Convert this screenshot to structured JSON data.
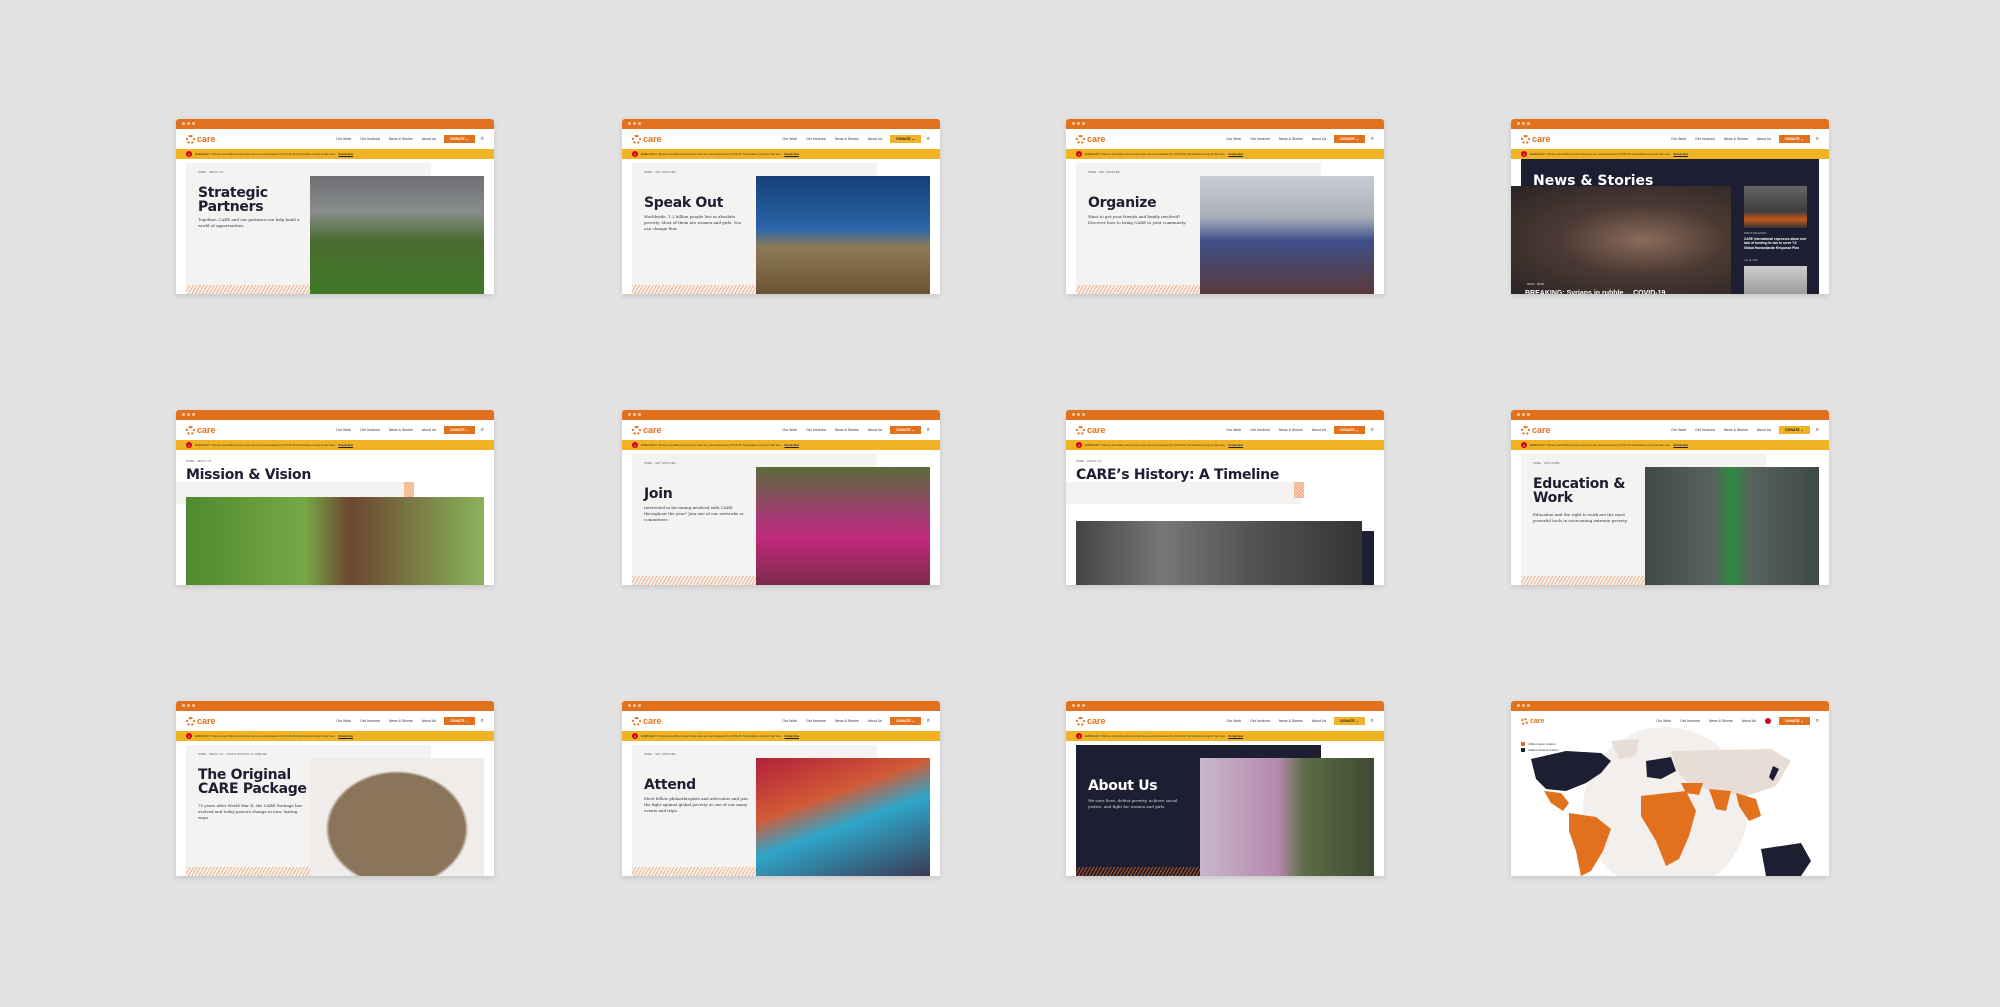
{
  "common": {
    "logo_text": "care",
    "nav": [
      "Our Work",
      "Get Involved",
      "News & Stories",
      "About Us"
    ],
    "donate_label": "DONATE ⌄",
    "search_icon": "⌕",
    "alert_icon": "!",
    "alert_text": "EMERGENCY: Women and children forced to flee home are now threatened by COVID-19. Help families running for their lives.",
    "alert_link": "Donate Now",
    "colors": {
      "brand_orange": "#e2711d",
      "alert_yellow": "#f0b323",
      "navy": "#1d1e31",
      "panel": "#f5f3f1",
      "background": "#e2e2e2"
    }
  },
  "cards": [
    {
      "breadcrumb": "HOME · ABOUT US",
      "title": "Strategic Partners",
      "description": "Together, CARE and our partners can help build a world of opportunities.",
      "donate_style": "orange"
    },
    {
      "breadcrumb": "HOME · GET INVOLVED",
      "title": "Speak Out",
      "description": "Worldwide, 1.2 billion people live in absolute poverty. Most of them are women and girls. You can change that.",
      "donate_style": "yellow"
    },
    {
      "breadcrumb": "HOME · GET INVOLVED",
      "title": "Organize",
      "description": "Want to get your friends and family involved? Discover how to bring CARE to your community.",
      "donate_style": "orange"
    },
    {
      "title": "News & Stories",
      "donate_style": "orange",
      "featured_tag": "NEWS · NEWS",
      "featured_headline": "BREAKING: Syrians in rubble ... COVID-19",
      "side_category": "PRESS RELEASES",
      "side_headline": "CARE International expresses alarm over lack of funding for aim to serve '19 Global Humanitarian Response Plan",
      "side_date": "July 16, 2020"
    },
    {
      "breadcrumb": "HOME · ABOUT US",
      "title": "Mission & Vision",
      "donate_style": "orange"
    },
    {
      "breadcrumb": "HOME · GET INVOLVED",
      "title": "Join",
      "description": "Interested in becoming involved with CARE throughout the year? Join one of our networks or committees.",
      "donate_style": "orange"
    },
    {
      "breadcrumb": "HOME · ABOUT US",
      "title": "CARE’s History: A Timeline",
      "donate_style": "orange"
    },
    {
      "breadcrumb": "HOME · OUR WORK",
      "title": "Education & Work",
      "description": "Education and the right to work are the most powerful tools in overcoming extreme poverty.",
      "donate_style": "yellow"
    },
    {
      "breadcrumb": "HOME · ABOUT US · CARE'S HISTORY: A TIMELINE",
      "title": "The Original CARE Package",
      "description": "75 years after World War II, the CARE Package has evolved and today powers change in new, lasting ways.",
      "donate_style": "orange"
    },
    {
      "breadcrumb": "HOME · GET INVOLVED",
      "title": "Attend",
      "description": "Meet fellow philanthropists and advocates and join the fight against global poverty at one of our many events and trips.",
      "donate_style": "orange"
    },
    {
      "title": "About Us",
      "description": "We save lives, defeat poverty, achieve social justice, and fight for women and girls.",
      "donate_style": "yellow"
    },
    {
      "title": "Map",
      "donate_style": "orange",
      "legend": [
        "CARE program locations",
        "CARE fundraising locations"
      ],
      "legend_colors": [
        "#e2711d",
        "#1d1e31"
      ]
    }
  ]
}
